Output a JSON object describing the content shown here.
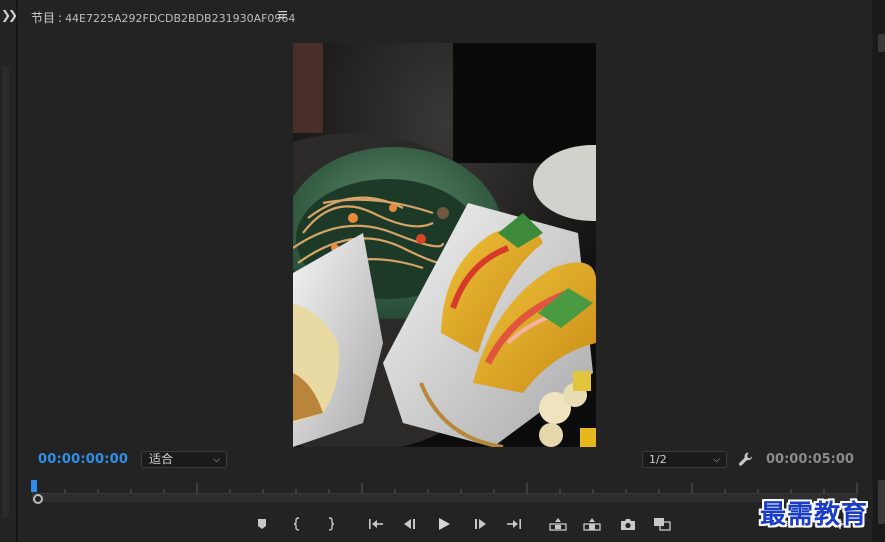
{
  "header": {
    "panel_label": "节目",
    "separator": ":",
    "sequence_name": "44E7225A292FDCDB2BDB231930AF0964",
    "menu_icon": "hamburger-menu-icon"
  },
  "controls": {
    "current_timecode": "00:00:00:00",
    "fit_value": "适合",
    "resolution_value": "1/2",
    "duration_timecode": "00:00:05:00"
  },
  "transport": {
    "icons": [
      "marker-icon",
      "mark-in-icon",
      "mark-out-icon",
      "go-to-in-icon",
      "step-back-icon",
      "play-icon",
      "step-forward-icon",
      "go-to-out-icon",
      "lift-icon",
      "extract-icon",
      "export-frame-icon",
      "comparison-view-icon",
      "add-button-icon"
    ]
  },
  "colors": {
    "accent": "#2f8fe8",
    "panel_bg": "#232323",
    "watermark": "#1a3cc8"
  },
  "watermark": {
    "text": "最需教育"
  }
}
